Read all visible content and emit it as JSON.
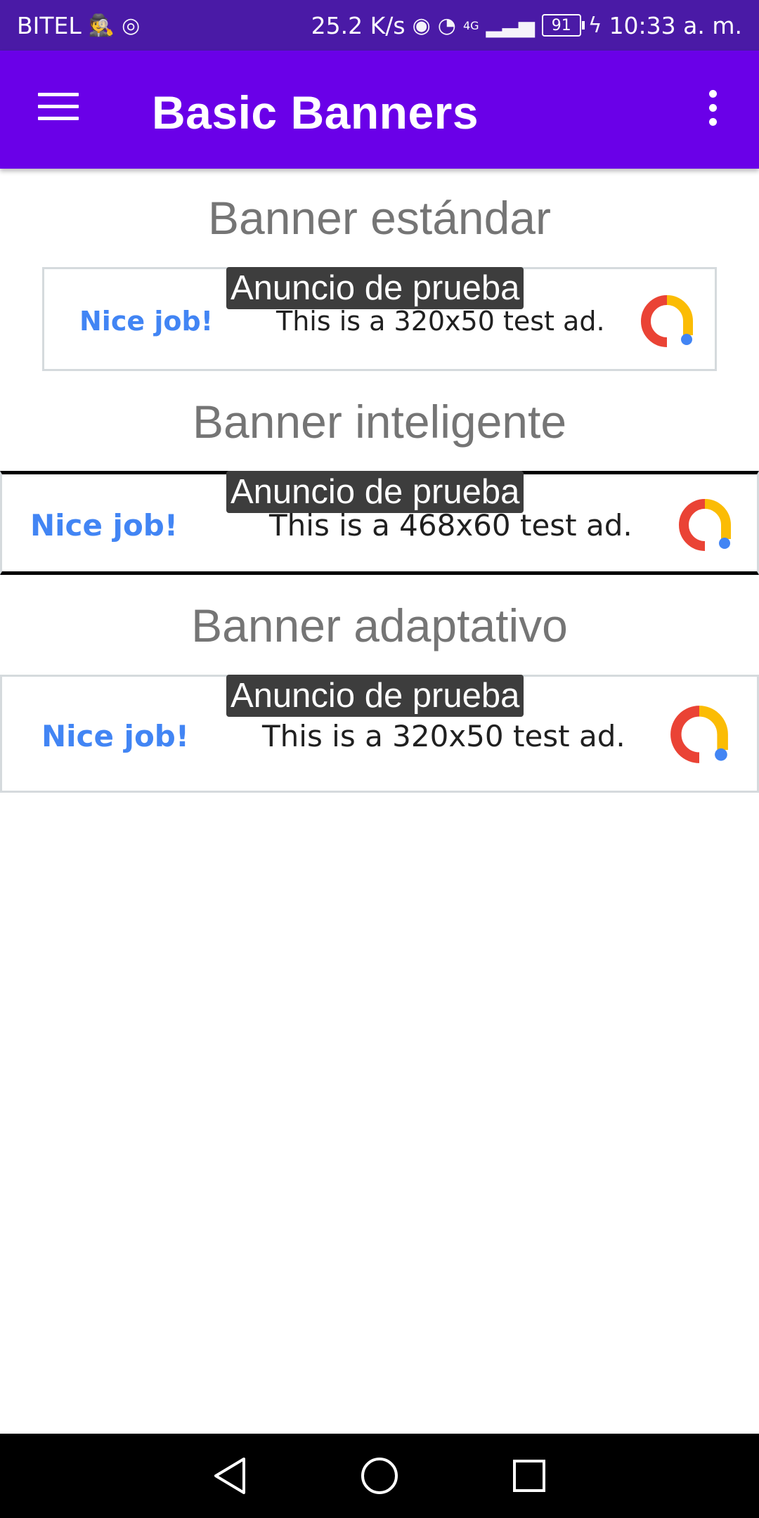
{
  "status_bar": {
    "carrier": "BITEL",
    "speed": "25.2 K/s",
    "network": "4G",
    "battery": "91",
    "time": "10:33 a. m."
  },
  "app_bar": {
    "title": "Basic Banners",
    "menu_icon": "hamburger-menu-icon",
    "overflow_icon": "more-vert-icon"
  },
  "sections": [
    {
      "title": "Banner estándar",
      "ad_tag": "Anuncio de prueba",
      "ad_headline": "Nice job!",
      "ad_text": "This is a 320x50 test ad."
    },
    {
      "title": "Banner inteligente",
      "ad_tag": "Anuncio de prueba",
      "ad_headline": "Nice job!",
      "ad_text": "This is a 468x60 test ad."
    },
    {
      "title": "Banner adaptativo",
      "ad_tag": "Anuncio de prueba",
      "ad_headline": "Nice job!",
      "ad_text": "This is a 320x50 test ad."
    }
  ],
  "colors": {
    "status_bar": "#4a1aa6",
    "app_bar": "#6a00e8",
    "title_gray": "#757575",
    "ad_blue": "#4285f4",
    "ad_tag_bg": "#3d3d3d"
  }
}
